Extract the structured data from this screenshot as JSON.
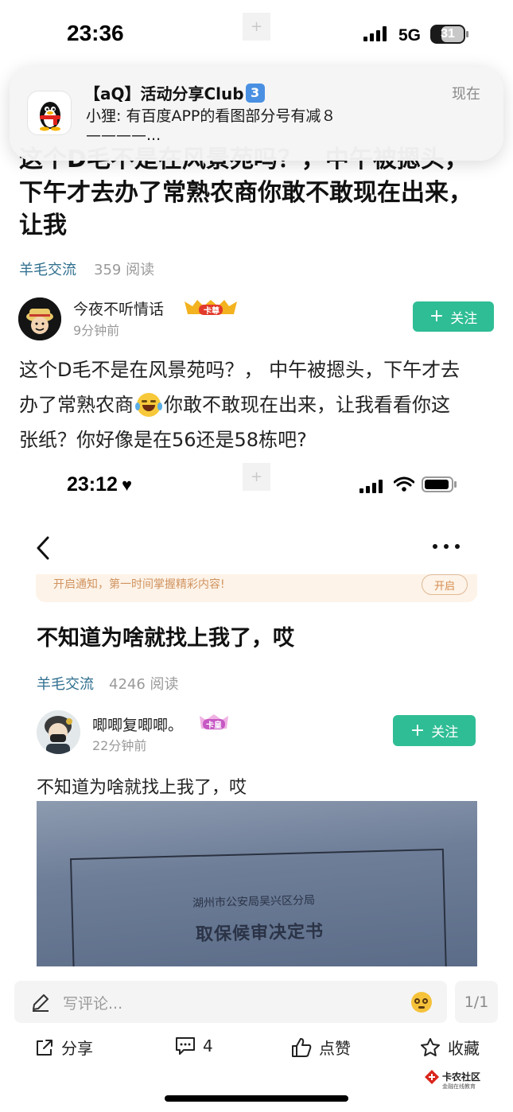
{
  "status_bar_top": {
    "time": "23:36",
    "network": "5G",
    "battery": "31"
  },
  "notification": {
    "title": "【aQ】活动分享Club",
    "title_badge": "3",
    "time": "现在",
    "message": "小狸: 有百度APP的看图部分号有减８",
    "message_cont": "————...",
    "app_icon": "qq-penguin-icon"
  },
  "post1": {
    "title_partial_line": "这个D毛不是在风景苑吗？，中午被摁头，",
    "title_line2": "下午才去办了常熟农商你敢不敢现在出来，",
    "title_line3": "让我",
    "category": "羊毛交流",
    "reads": "359 阅读",
    "author": "今夜不听情话",
    "badge": "卡尊",
    "posted": "9分钟前",
    "follow_label": "关注",
    "body_line1": "这个D毛不是在风景苑吗？， 中午被摁头，下午才去",
    "body_line2a": "办了常熟农商",
    "body_line2b": "你敢不敢现在出来，让我看看你这",
    "body_line3": "张纸？你好像是在56还是58栋吧?"
  },
  "status_bar_embedded": {
    "time": "23:12"
  },
  "post2": {
    "notice": "开启通知，第一时间掌握精彩内容!",
    "notice_button": "开启",
    "title": "不知道为啥就找上我了，哎",
    "category": "羊毛交流",
    "reads": "4246 阅读",
    "author": "唧唧复唧唧。",
    "badge": "卡皇",
    "posted": "22分钟前",
    "follow_label": "关注",
    "body": "不知道为啥就找上我了，哎",
    "photo_text_line1": "湖州市公安局吴兴区分局",
    "photo_text_line2": "取保候审决定书"
  },
  "bottom": {
    "comment_placeholder": "写评论...",
    "page_indicator": "1/1",
    "share": "分享",
    "comments_count": "4",
    "like": "点赞",
    "favorite": "收藏",
    "watermark_main": "卡农社区",
    "watermark_sub": "金融在线教育"
  },
  "colors": {
    "accent": "#2fbd95",
    "category_text": "#2f6f8f",
    "notice_bg": "#fdf3e8"
  }
}
